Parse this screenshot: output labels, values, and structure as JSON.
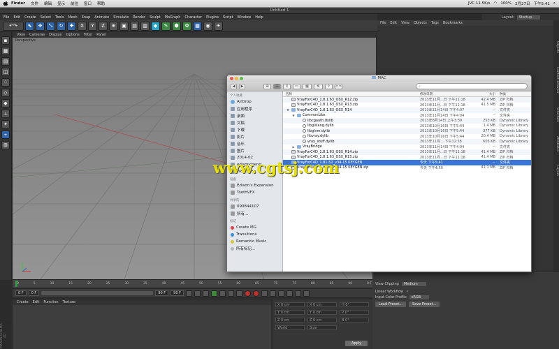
{
  "menubar": {
    "app": "Finder",
    "items": [
      "文件",
      "编辑",
      "显示",
      "前往",
      "窗口",
      "帮助"
    ],
    "status": [
      "JVC 11.5K/s",
      "100%",
      "2月27日",
      "下午5:41"
    ]
  },
  "c4d": {
    "window_title": "Untitled 1",
    "menu": [
      "File",
      "Edit",
      "Create",
      "Select",
      "Tools",
      "Mesh",
      "Snap",
      "Animate",
      "Simulate",
      "Render",
      "Sculpt",
      "MoGraph",
      "Character",
      "Plugins",
      "Script",
      "Window",
      "Help"
    ],
    "layout_label": "Layout:",
    "layout_value": "Startup",
    "viewport_menu": [
      "View",
      "Cameras",
      "Display",
      "Options",
      "Filter",
      "Panel"
    ],
    "viewport_label": "Perspective",
    "objects_menu": [
      "File",
      "Edit",
      "View",
      "Objects",
      "Tags",
      "Bookmarks"
    ],
    "timeline_ticks": [
      "0",
      "5",
      "10",
      "15",
      "20",
      "25",
      "30",
      "35",
      "40",
      "45",
      "50",
      "55",
      "60",
      "65",
      "70",
      "75",
      "80",
      "85",
      "90",
      "0 F"
    ],
    "transport": {
      "start": "0 F",
      "current": "0 F",
      "end": "90 F",
      "end2": "90 F"
    },
    "material_menu": [
      "Create",
      "Edit",
      "Function",
      "Texture"
    ],
    "coords": {
      "rows": [
        [
          "X",
          "0 cm",
          "X",
          "0 cm",
          "H",
          "0°"
        ],
        [
          "Y",
          "0 cm",
          "Y",
          "0 cm",
          "P",
          "0°"
        ],
        [
          "Z",
          "0 cm",
          "Z",
          "0 cm",
          "B",
          "0°"
        ]
      ],
      "mode1": "World",
      "mode2": "Size",
      "apply": "Apply"
    },
    "attributes": {
      "view_clipping_label": "View Clipping",
      "view_clipping_value": "Medium",
      "linear_workflow_label": "Linear Workflow",
      "linear_workflow_value": "✓",
      "input_color_label": "Input Color Profile",
      "input_color_value": "sRGB",
      "load_preset": "Load Preset...",
      "save_preset": "Save Preset..."
    },
    "right_tabs": [
      "Objects",
      "Content Browser",
      "Structure",
      "Attributes",
      "Layers"
    ],
    "brand": "MAXON CINEMA 4D"
  },
  "finder": {
    "title": "MAC",
    "search_placeholder": "",
    "sidebar": {
      "favorites_header": "个人收藏",
      "favorites": [
        "AirDrop",
        "应用程序",
        "桌面",
        "文稿",
        "下载",
        "影片",
        "音乐",
        "图片",
        "2014-02",
        "edisoncheng",
        "Workshop"
      ],
      "devices_header": "设备",
      "devices": [
        "Edison's Expansion",
        "ToothVFX"
      ],
      "shared_header": "共享的",
      "shared": [
        "090844107",
        "所有..."
      ],
      "tags_header": "标记",
      "tags": [
        {
          "label": "Create MG",
          "color": "#e0404a"
        },
        {
          "label": "Transitions",
          "color": "#3b8fe0"
        },
        {
          "label": "Romantic Music",
          "color": "#d8c93a"
        },
        {
          "label": "所有标记...",
          "color": "#b8b8b8"
        }
      ]
    },
    "columns": [
      "名称",
      "修改日期",
      "大小",
      "种类"
    ],
    "rows": [
      {
        "indent": 0,
        "tri": "",
        "icon": "zip",
        "name": "VrayForC4D_1.8.1.63_OSX_R12.zip",
        "date": "2013年11月...日 下午11:18",
        "size": "42.4 MB",
        "kind": "ZIP 归档"
      },
      {
        "indent": 0,
        "tri": "",
        "icon": "zip",
        "name": "VrayForC4D_1.8.1.63_OSX_R13.zip",
        "date": "2013年11月...日 下午11:18",
        "size": "41.5 MB",
        "kind": "ZIP 归档"
      },
      {
        "indent": 0,
        "tri": "▼",
        "icon": "folder",
        "name": "VrayForC4D_1.8.1.63_OSX_R14",
        "date": "2013年11月14日 下午4:07",
        "size": "--",
        "kind": "文件夹"
      },
      {
        "indent": 1,
        "tri": "▼",
        "icon": "folder",
        "name": "CommonLibs",
        "date": "2013年11月14日 下午4:04",
        "size": "--",
        "kind": "文件夹"
      },
      {
        "indent": 2,
        "tri": "",
        "icon": "lib",
        "name": "libcgauth.dylib",
        "date": "2013年8月14日 上午3:39",
        "size": "253 KB",
        "kind": "Dynamic Library"
      },
      {
        "indent": 2,
        "tri": "",
        "icon": "lib",
        "name": "libglslang.dylib",
        "date": "2013年10月16日 下午5:44",
        "size": "1.4 MB",
        "kind": "Dynamic Library"
      },
      {
        "indent": 2,
        "tri": "",
        "icon": "lib",
        "name": "libglvm.dylib",
        "date": "2013年10月16日 下午5:44",
        "size": "377 KB",
        "kind": "Dynamic Library"
      },
      {
        "indent": 2,
        "tri": "",
        "icon": "lib",
        "name": "libvray.dylib",
        "date": "2013年10月16日 下午5:44",
        "size": "20.4 MB",
        "kind": "Dynamic Library"
      },
      {
        "indent": 2,
        "tri": "",
        "icon": "lib",
        "name": "vray_stuff.dylib",
        "date": "2013年11月... 下午12:58",
        "size": "603 KB",
        "kind": "Dynamic Library"
      },
      {
        "indent": 1,
        "tri": "▶",
        "icon": "folder",
        "name": "VrayBridge",
        "date": "2013年11月14日 下午4:04",
        "size": "--",
        "kind": "文件夹"
      },
      {
        "indent": 0,
        "tri": "",
        "icon": "zip",
        "name": "VrayForC4D_1.8.1.63_OSX_R14.zip",
        "date": "2013年11月...日 下午11:18",
        "size": "41.4 MB",
        "kind": "ZIP 归档"
      },
      {
        "indent": 0,
        "tri": "",
        "icon": "zip",
        "name": "VrayForC4D_1.8.1.63_OSX_R15.zip",
        "date": "2013年11月...日 下午11:18",
        "size": "41.4 MB",
        "kind": "ZIP 归档"
      },
      {
        "indent": 0,
        "tri": "▶",
        "icon": "folder",
        "name": "VrayForC4D_1.81-52_v34-15 KEYGEN",
        "date": "今天 下午5:41",
        "size": "--",
        "kind": "文件夹",
        "selected": true
      },
      {
        "indent": 0,
        "tri": "",
        "icon": "zip",
        "name": "VrayForC4D_1.81-52_v34-15 KEYGEN.zip",
        "date": "今天 下午4:59",
        "size": "41.1 MB",
        "kind": "ZIP 归档"
      }
    ]
  },
  "watermark": "www.cgtsj.com"
}
